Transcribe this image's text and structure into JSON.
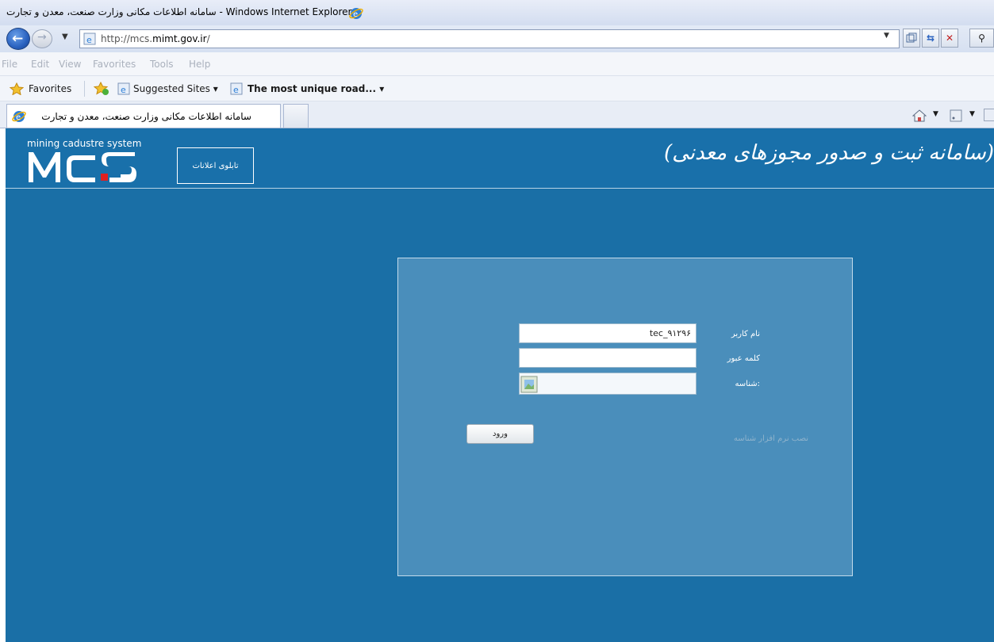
{
  "browser": {
    "window_title": "سامانه اطلاعات مکانی وزارت صنعت، معدن و تجارت - Windows Internet Explorer",
    "url_prefix": "http://mcs.",
    "url_domain": "mimt.gov.ir",
    "url_suffix": "/",
    "menu": [
      "File",
      "Edit",
      "View",
      "Favorites",
      "Tools",
      "Help"
    ],
    "favorites_label": "Favorites",
    "suggested_sites_label": "Suggested Sites ▾",
    "favorite_link_label": "The most unique road... ▾",
    "tab_title": "سامانه اطلاعات مکانی وزارت صنعت، معدن و تجارت"
  },
  "header": {
    "tagline": "mining cadustre system",
    "logo_text": "MCS",
    "bulletin_button": "تابلوی اعلانات",
    "system_title": "(سامانه ثبت و صدور مجوزهای معدنی)"
  },
  "login": {
    "username_label": "نام کاربر",
    "username_value": "tec_۹۱۲۹۶",
    "password_label": "کلمه عبور",
    "password_value": "",
    "captcha_label": "شناسه:",
    "login_button": "ورود",
    "install_link": "نصب نرم افزار شناسه"
  },
  "colors": {
    "page_background": "#1a6fa6",
    "panel_background": "#4a8ebb",
    "logo_accent": "#e02020"
  }
}
